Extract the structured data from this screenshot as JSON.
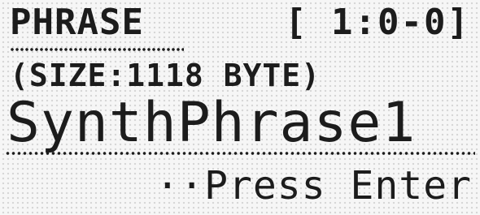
{
  "display": {
    "mode_title": "PHRASE",
    "position_readout": "[ 1:0-0]",
    "size_info": "(SIZE:1118 BYTE)",
    "phrase_name": "SynthPhrase1",
    "prompt": "··Press Enter"
  },
  "colors": {
    "lcd_background": "#f6f6f6",
    "lcd_text": "#1c1c1c"
  }
}
